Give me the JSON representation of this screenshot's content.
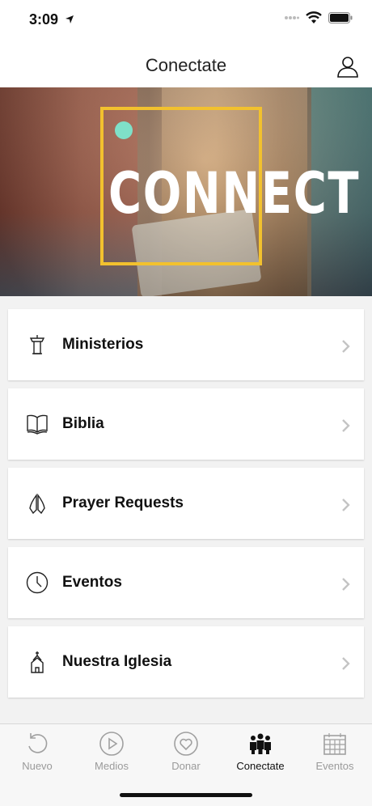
{
  "status_bar": {
    "time": "3:09"
  },
  "nav": {
    "title": "Conectate"
  },
  "hero": {
    "text": "CONNECT"
  },
  "menu": {
    "items": [
      {
        "label": "Ministerios",
        "icon": "pulpit-icon"
      },
      {
        "label": "Biblia",
        "icon": "bible-icon"
      },
      {
        "label": "Prayer Requests",
        "icon": "praying-hands-icon"
      },
      {
        "label": "Eventos",
        "icon": "clock-icon"
      },
      {
        "label": "Nuestra Iglesia",
        "icon": "church-icon"
      }
    ]
  },
  "tabs": [
    {
      "label": "Nuevo",
      "icon": "refresh-icon",
      "active": false
    },
    {
      "label": "Medios",
      "icon": "play-icon",
      "active": false
    },
    {
      "label": "Donar",
      "icon": "heart-icon",
      "active": false
    },
    {
      "label": "Conectate",
      "icon": "people-icon",
      "active": true
    },
    {
      "label": "Eventos",
      "icon": "calendar-icon",
      "active": false
    }
  ],
  "colors": {
    "accent_frame": "#f2c12e",
    "active_tab": "#111111",
    "inactive_tab": "#9a9a9a"
  }
}
